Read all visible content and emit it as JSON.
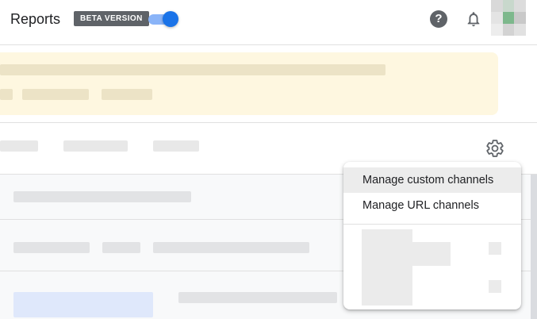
{
  "header": {
    "title": "Reports",
    "beta_label": "BETA VERSION",
    "beta_toggle_on": true,
    "help_glyph": "?",
    "icons": [
      "help-icon",
      "notifications-bell-icon",
      "settings-gear-icon"
    ]
  },
  "settings_menu": {
    "items": [
      {
        "label": "Manage custom channels",
        "hovered": true
      },
      {
        "label": "Manage URL channels",
        "hovered": false
      }
    ]
  },
  "colors": {
    "accent": "#1a73e8",
    "notice_background": "#fef7e0",
    "beta_badge": "#5f6368"
  }
}
